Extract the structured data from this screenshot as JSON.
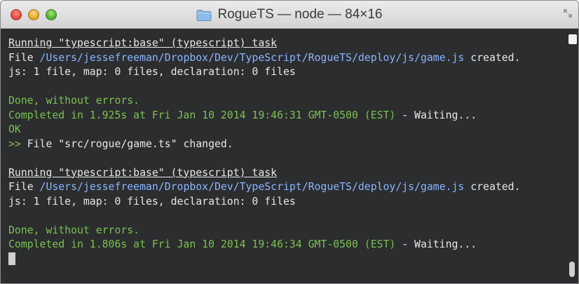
{
  "window": {
    "title": "RogueTS — node — 84×16"
  },
  "terminal": {
    "lines": [
      "Running \"typescript:base\" (typescript) task",
      "/Users/jessefreeman/Dropbox/Dev/TypeScript/RogueTS/deploy/js/game.js",
      "js: 1 file, map: 0 files, declaration: 0 files",
      "",
      "Done, without errors.",
      "Completed in 1.925s at Fri Jan 10 2014 19:46:31 GMT-0500 (EST)",
      "OK",
      "File \"src/rogue/game.ts\" changed.",
      "",
      "Running \"typescript:base\" (typescript) task",
      "/Users/jessefreeman/Dropbox/Dev/TypeScript/RogueTS/deploy/js/game.js",
      "js: 1 file, map: 0 files, declaration: 0 files",
      "",
      "Done, without errors.",
      "Completed in 1.806s at Fri Jan 10 2014 19:46:34 GMT-0500 (EST)"
    ],
    "file_prefix": "File ",
    "created_suffix": " created.",
    "waiting_suffix": " - Waiting...",
    "change_prefix": ">> "
  },
  "icons": {
    "window_close": "close-traffic-light-icon",
    "window_minimize": "minimize-traffic-light-icon",
    "window_maximize": "maximize-traffic-light-icon",
    "folder": "folder-icon",
    "fullscreen": "fullscreen-icon"
  },
  "colors": {
    "terminal_bg": "#2b2d2f",
    "terminal_text": "#e7e7e7",
    "success_green": "#7cc14f",
    "path_blue": "#8cb5ff"
  }
}
